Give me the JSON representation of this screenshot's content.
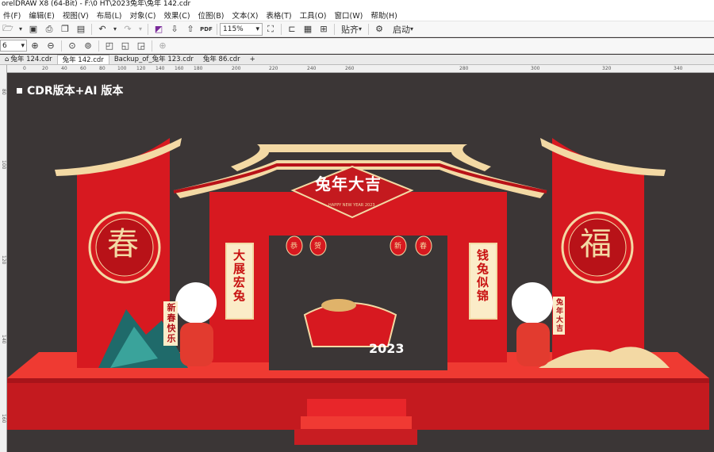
{
  "window": {
    "title": "orelDRAW X8 (64-Bit) - F:\\0 HT\\2023兔年\\兔年 142.cdr"
  },
  "menu": [
    {
      "label": "件(F)"
    },
    {
      "label": "编辑(E)"
    },
    {
      "label": "视图(V)"
    },
    {
      "label": "布局(L)"
    },
    {
      "label": "对象(C)"
    },
    {
      "label": "效果(C)"
    },
    {
      "label": "位图(B)"
    },
    {
      "label": "文本(X)"
    },
    {
      "label": "表格(T)"
    },
    {
      "label": "工具(O)"
    },
    {
      "label": "窗口(W)"
    },
    {
      "label": "帮助(H)"
    }
  ],
  "toolbar": {
    "zoom": "115%",
    "snap_label": "贴齐",
    "launch_label": "启动",
    "pdf_label": "PDF"
  },
  "toolbar2": {
    "size_value": "6"
  },
  "tabs": [
    {
      "label": "兔年 124.cdr"
    },
    {
      "label": "兔年 142.cdr"
    },
    {
      "label": "Backup_of_兔年 123.cdr"
    },
    {
      "label": "兔年 86.cdr"
    }
  ],
  "ruler": {
    "h": [
      "0",
      "20",
      "40",
      "60",
      "80",
      "100",
      "120",
      "140",
      "160",
      "180",
      "200",
      "220",
      "240",
      "260",
      "280",
      "300",
      "320",
      "340"
    ],
    "v": [
      "80",
      "100",
      "120",
      "140",
      "160"
    ]
  },
  "artwork": {
    "caption": "CDR版本+AI 版本",
    "banner": "兔年大吉",
    "banner_sub": "HAPPY NEW YEAR 2023",
    "left_pillar": "春",
    "right_pillar": "福",
    "left_scroll": "大展宏兔",
    "right_scroll": "钱兔似锦",
    "lanterns": [
      "恭",
      "贺",
      "新",
      "春"
    ],
    "rabbit_left_scroll": "新春快乐",
    "rabbit_right_scroll": "兔年大吉",
    "year": "2023"
  },
  "colors": {
    "red": "#d71920",
    "dark_red": "#b01018",
    "gold": "#f3d9a4",
    "canvas": "#3b3636",
    "stage": "#e01f26"
  }
}
